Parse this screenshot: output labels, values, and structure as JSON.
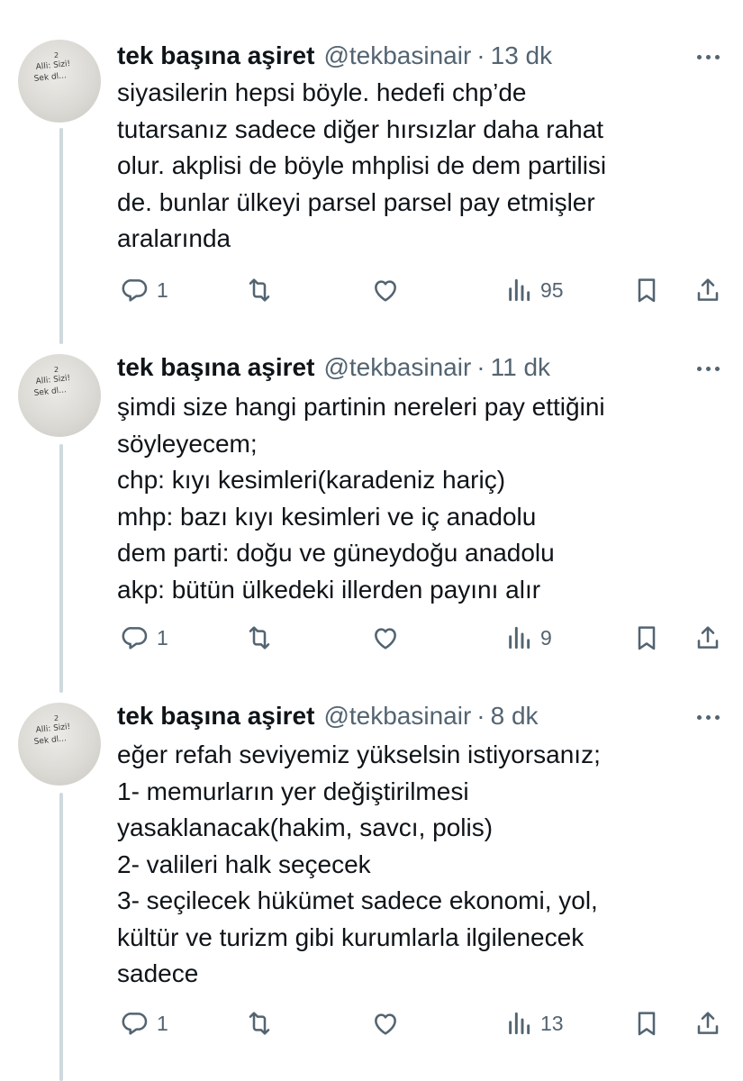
{
  "tweets": [
    {
      "author": "tek başına aşiret",
      "handle": "@tekbasinair",
      "separator": "·",
      "time": "13 dk",
      "lines": [
        "siyasilerin hepsi böyle. hedefi chp’de",
        "tutarsanız sadece diğer hırsızlar daha rahat",
        "olur. akplisi de böyle mhplisi de dem partilisi",
        "de. bunlar ülkeyi parsel parsel pay etmişler",
        "aralarında"
      ],
      "replies": "1",
      "views": "95"
    },
    {
      "author": "tek başına aşiret",
      "handle": "@tekbasinair",
      "separator": "·",
      "time": "11 dk",
      "lines": [
        "şimdi size hangi partinin nereleri pay ettiğini",
        "söyleyecem;",
        "chp: kıyı kesimleri(karadeniz hariç)",
        "mhp: bazı kıyı kesimleri ve iç anadolu",
        "dem parti: doğu ve güneydoğu anadolu",
        "akp: bütün ülkedeki illerden payını alır"
      ],
      "replies": "1",
      "views": "9"
    },
    {
      "author": "tek başına aşiret",
      "handle": "@tekbasinair",
      "separator": "·",
      "time": "8 dk",
      "lines": [
        "eğer refah seviyemiz yükselsin istiyorsanız;",
        "1- memurların yer değiştirilmesi",
        "yasaklanacak(hakim, savcı, polis)",
        "2- valileri halk seçecek",
        "3- seçilecek hükümet sadece ekonomi, yol,",
        "kültür ve turizm gibi kurumlarla ilgilenecek",
        "sadece"
      ],
      "replies": "1",
      "views": "13"
    }
  ],
  "avatar_scribble": [
    "2",
    "Alli: Sizi!",
    "Sek dl..."
  ],
  "colors": {
    "text": "#0f1419",
    "secondary": "#536471",
    "thread_line": "#cfd9de"
  },
  "icons": [
    "reply-icon",
    "retweet-icon",
    "like-icon",
    "views-icon",
    "bookmark-icon",
    "share-icon",
    "more-icon"
  ]
}
